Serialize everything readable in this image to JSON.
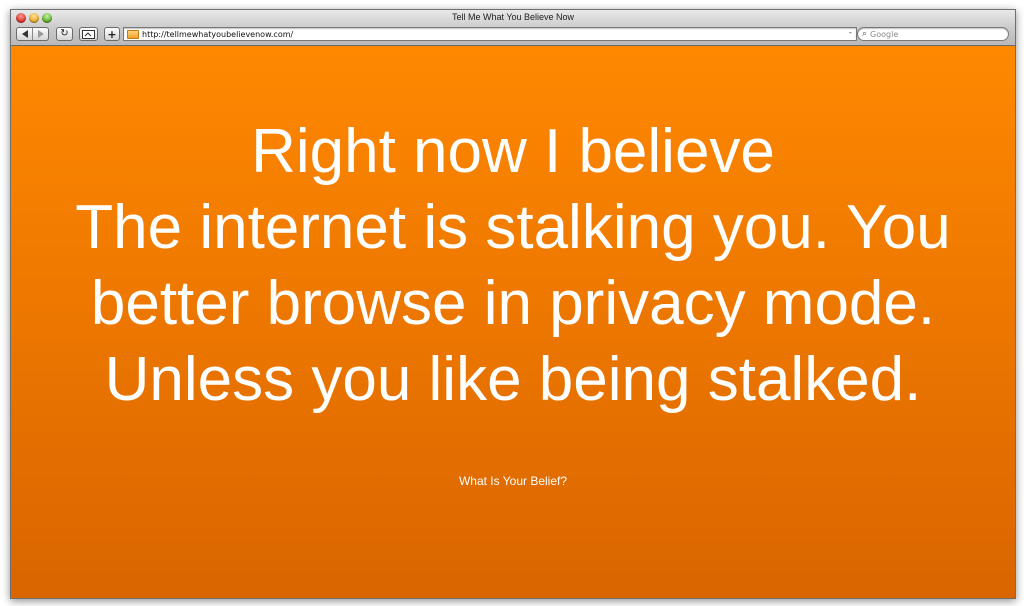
{
  "window": {
    "title": "Tell Me What You Believe Now"
  },
  "toolbar": {
    "back_icon": "back-arrow-icon",
    "forward_icon": "forward-arrow-icon",
    "reload_icon": "reload-icon",
    "snapback_icon": "snapback-icon",
    "add_bookmark_label": "+",
    "url": "http://tellmewhatyoubelievenow.com/",
    "search_placeholder": "Google",
    "search_engine_toggle": "-"
  },
  "page": {
    "belief_lines": [
      "Right now I believe",
      "The internet is stalking you. You",
      "better browse in privacy mode.",
      "Unless you like being stalked."
    ],
    "link_text": "What Is Your Belief?"
  },
  "colors": {
    "background_top": "#ff8800",
    "background_bottom": "#d96500",
    "text": "#ffffff"
  }
}
